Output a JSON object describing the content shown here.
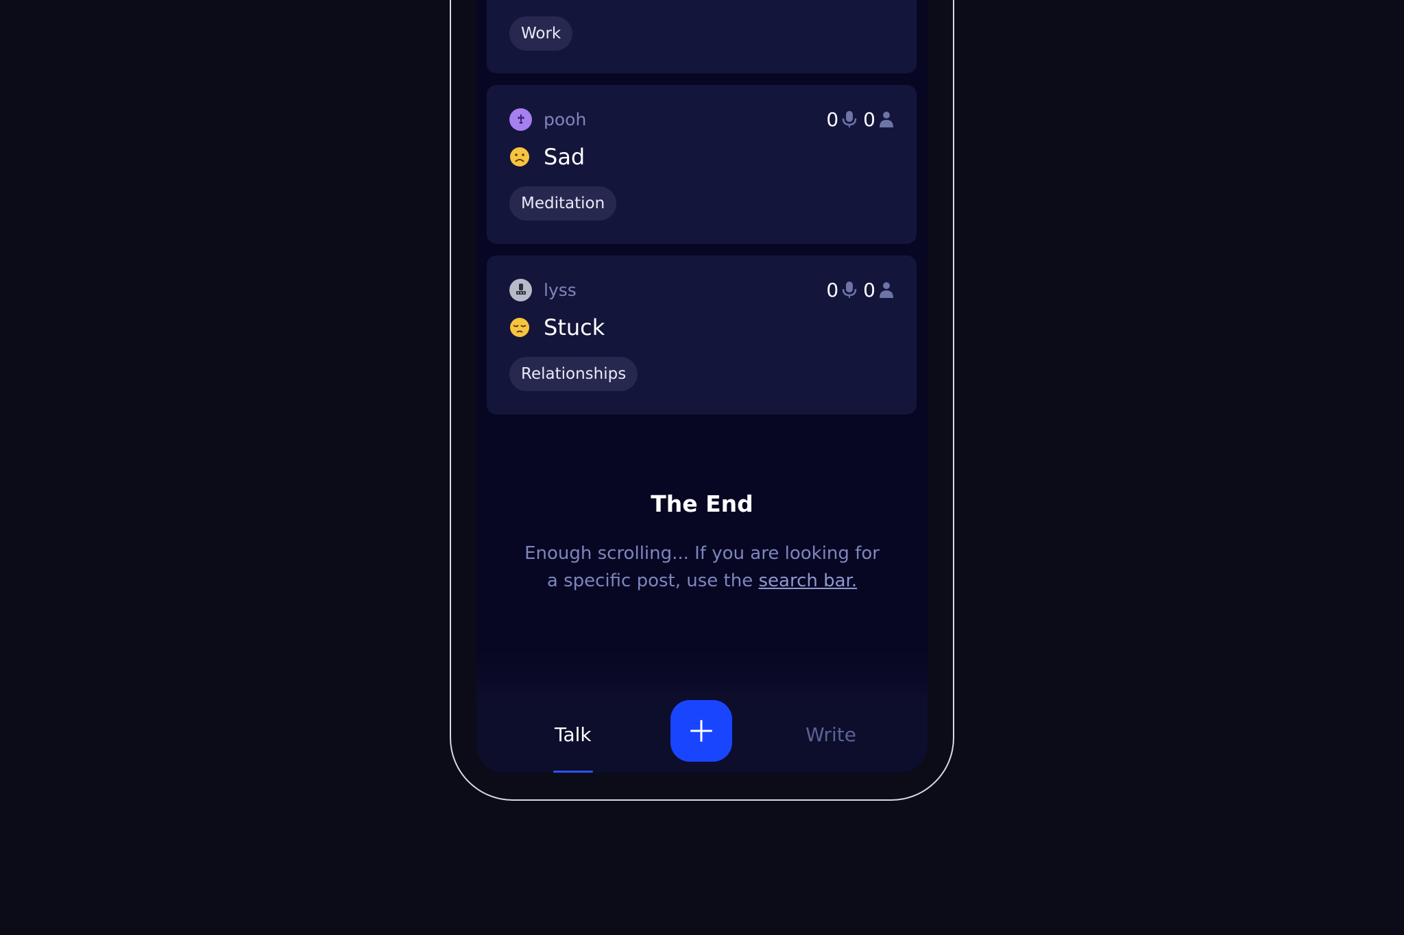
{
  "feed": {
    "top_card": {
      "tag": "Work"
    },
    "posts": [
      {
        "username": "pooh",
        "avatar_icon": "purple-creature-avatar",
        "mood": "Sad",
        "mood_icon": "frowning-face-emoji",
        "voice_count": "0",
        "listener_count": "0",
        "tag": "Meditation"
      },
      {
        "username": "lyss",
        "avatar_icon": "gray-robot-avatar",
        "mood": "Stuck",
        "mood_icon": "pensive-face-emoji",
        "voice_count": "0",
        "listener_count": "0",
        "tag": "Relationships"
      }
    ]
  },
  "end_section": {
    "title": "The End",
    "text": "Enough scrolling... If you are looking for a specific post, use the",
    "link_text": "search bar."
  },
  "bottom_nav": {
    "talk_label": "Talk",
    "write_label": "Write",
    "active_tab": "Talk"
  },
  "colors": {
    "background": "#0b0c17",
    "screen": "#070723",
    "card": "#14153a",
    "tag": "#27284f",
    "accent": "#1a45ff",
    "muted_text": "#7e86bd"
  }
}
